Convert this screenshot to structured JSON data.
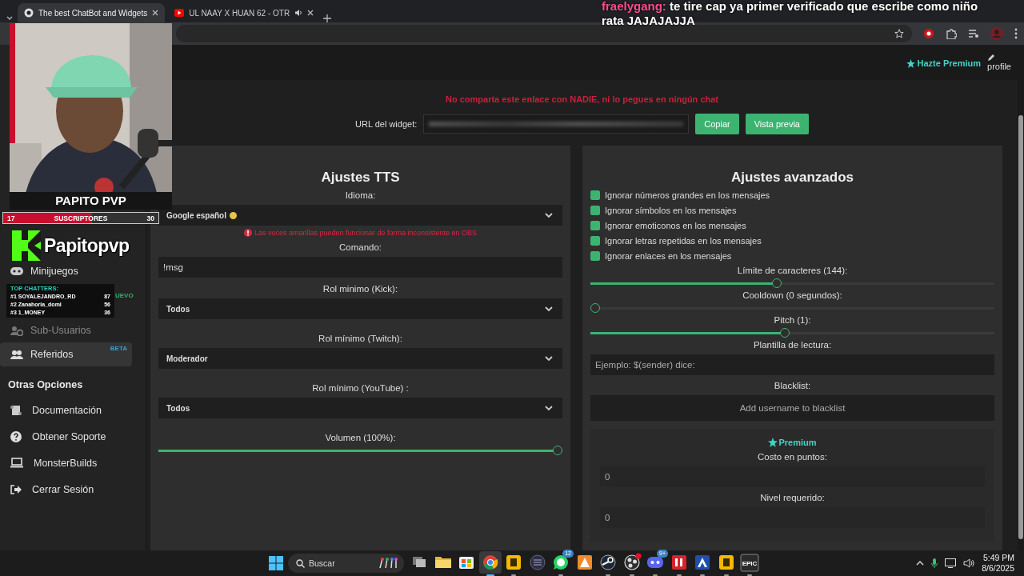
{
  "browser": {
    "tabs": [
      {
        "kind": "site",
        "title": "The best ChatBot and Widgets",
        "selected": true,
        "audio": false
      },
      {
        "kind": "video",
        "title": "UL NAAY X HUAN 62 - OTR",
        "selected": false,
        "audio": true
      }
    ]
  },
  "chat_overlay": {
    "user": "fraelygang:",
    "message": "te tire cap ya primer verificado que escribe como niño rata JAJAJAJJA"
  },
  "webcam": {
    "kind": "picture",
    "name": "PAPITO PVP"
  },
  "sub_goal": {
    "current": "17",
    "label": "SUSCRIPTORES",
    "goal": "30",
    "level": 0.57
  },
  "channel_badge": {
    "name": "Papitopvp"
  },
  "top_chatters": {
    "title": "TOP CHATTERS:",
    "rows": [
      {
        "name": "#1 SOYALEJANDRO_RD",
        "count": "87"
      },
      {
        "name": "#2 Zanahoria_domi",
        "count": "56"
      },
      {
        "name": "#3 1_MONEY",
        "count": "36"
      }
    ]
  },
  "sidebar": {
    "items": [
      {
        "kind": "gamepad",
        "label": "Minijuegos",
        "selected": false,
        "disabled": false
      },
      {
        "kind": "users-cog",
        "label": "Sub-Usuarios",
        "selected": false,
        "disabled": true
      },
      {
        "kind": "users",
        "label": "Referidos",
        "badge": "BETA",
        "selected": true,
        "disabled": false
      }
    ],
    "peek_badge": "UEVO",
    "section_title": "Otras Opciones",
    "other_items": [
      {
        "kind": "scroll",
        "label": "Documentación"
      },
      {
        "kind": "question",
        "label": "Obtener Soporte"
      },
      {
        "kind": "laptop",
        "label": "MonsterBuilds"
      },
      {
        "kind": "logout",
        "label": "Cerrar Sesión"
      }
    ]
  },
  "header": {
    "premium_link": "Hazte Premium",
    "profile_link": "profile"
  },
  "widget": {
    "warning": "No comparta este enlace con NADIE, ni lo pegues en ningún chat",
    "url_label": "URL del widget:",
    "buttons": [
      "Copiar",
      "Vista previa"
    ]
  },
  "tts": {
    "title": "Ajustes TTS",
    "fields": [
      {
        "kind": "select",
        "label": "Idioma:",
        "value": "Google español",
        "color": "#e6c44d",
        "note": "Las voces amarillas pueden funcionar de forma inconsistente en OBS"
      },
      {
        "kind": "input",
        "label": "Comando:",
        "value": "!msg"
      },
      {
        "kind": "select",
        "label": "Rol minimo (Kick):",
        "value": "Todos"
      },
      {
        "kind": "select",
        "label": "Rol mínimo (Twitch):",
        "value": "Moderador"
      },
      {
        "kind": "select",
        "label": "Rol mínimo (YouTube) :",
        "value": "Todos"
      },
      {
        "kind": "slider",
        "label": "Volumen (100%):",
        "level": 1
      }
    ]
  },
  "advanced": {
    "title": "Ajustes avanzados",
    "options": [
      {
        "label": "Ignorar números grandes en los mensajes",
        "checked": true
      },
      {
        "label": "Ignorar símbolos en los mensajes",
        "checked": true
      },
      {
        "label": "Ignorar emoticonos en los mensajes",
        "checked": true
      },
      {
        "label": "Ignorar letras repetidas en los mensajes",
        "checked": true
      },
      {
        "label": "Ignorar enlaces en los mensajes",
        "checked": true
      }
    ],
    "fields": [
      {
        "kind": "slider",
        "label": "Límite de caracteres (144):",
        "level": 0.46
      },
      {
        "kind": "slider",
        "label": "Cooldown (0 segundos):",
        "level": 0
      },
      {
        "kind": "slider",
        "label": "Pitch (1):",
        "level": 0.48
      },
      {
        "kind": "input",
        "label": "Plantilla de lectura:",
        "placeholder": "Ejemplo: $(sender) dice:"
      },
      {
        "kind": "tags",
        "label": "Blacklist:",
        "placeholder": "Add username to blacklist"
      }
    ],
    "premium": {
      "title": "Premium",
      "fields": [
        {
          "kind": "input",
          "label": "Costo en puntos:",
          "placeholder": "0"
        },
        {
          "kind": "input",
          "label": "Nivel requerido:",
          "placeholder": "0"
        }
      ]
    }
  },
  "taskbar": {
    "search_placeholder": "Buscar",
    "apps": [
      {
        "kind": "taskview",
        "selected": false,
        "running": false,
        "alert": false
      },
      {
        "kind": "folder",
        "selected": false,
        "running": false,
        "alert": false
      },
      {
        "kind": "store",
        "selected": false,
        "running": false,
        "alert": false
      },
      {
        "kind": "browser",
        "selected": true,
        "running": true,
        "alert": false
      },
      {
        "kind": "tile",
        "selected": false,
        "running": true,
        "alert": false
      },
      {
        "kind": "roundgrid",
        "selected": false,
        "running": false,
        "alert": false
      },
      {
        "kind": "chat",
        "selected": false,
        "running": true,
        "alert": false,
        "badge": "12"
      },
      {
        "kind": "cone",
        "selected": false,
        "running": false,
        "alert": false
      },
      {
        "kind": "knob",
        "selected": false,
        "running": true,
        "alert": false
      },
      {
        "kind": "record",
        "selected": false,
        "running": true,
        "alert": true
      },
      {
        "kind": "pad",
        "selected": false,
        "running": true,
        "alert": false,
        "badge": "9+"
      },
      {
        "kind": "bars",
        "selected": false,
        "running": true,
        "alert": false
      },
      {
        "kind": "triangle",
        "selected": false,
        "running": true,
        "alert": false
      },
      {
        "kind": "tile",
        "selected": false,
        "running": true,
        "alert": false
      },
      {
        "kind": "texttile",
        "label": "EPIC",
        "selected": false,
        "running": true,
        "alert": false
      }
    ],
    "time": "5:49 PM",
    "date": "8/6/2025"
  }
}
